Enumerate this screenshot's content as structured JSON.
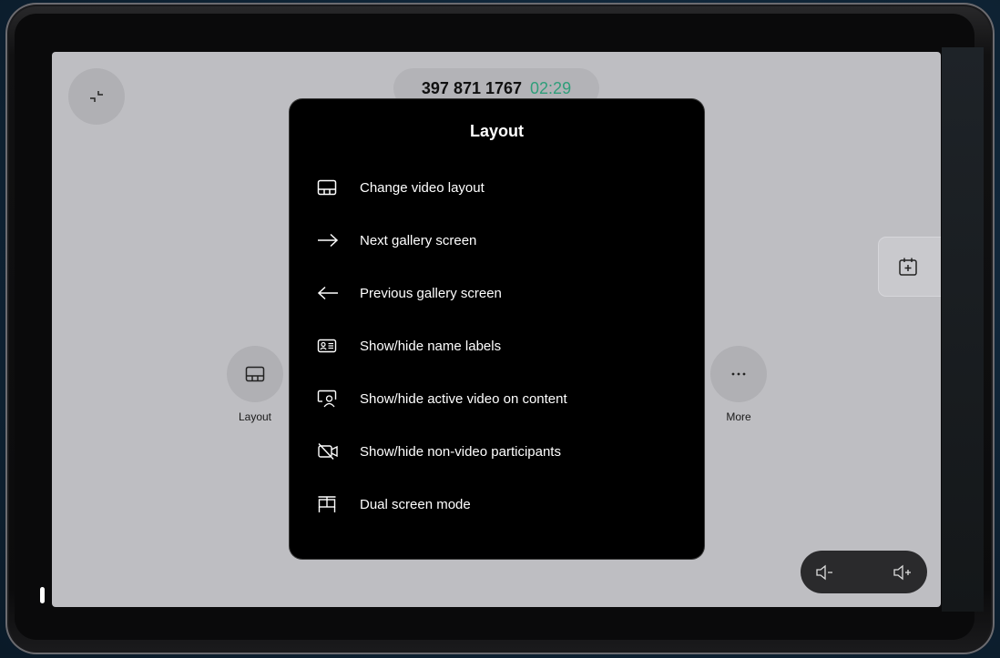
{
  "call": {
    "number": "397 871 1767",
    "duration": "02:29"
  },
  "dialog": {
    "title": "Layout",
    "items": [
      {
        "label": "Change video layout",
        "icon": "layout-icon"
      },
      {
        "label": "Next gallery screen",
        "icon": "arrow-right-icon"
      },
      {
        "label": "Previous gallery screen",
        "icon": "arrow-left-icon"
      },
      {
        "label": "Show/hide name labels",
        "icon": "name-label-icon"
      },
      {
        "label": "Show/hide active video on content",
        "icon": "active-video-icon"
      },
      {
        "label": "Show/hide non-video participants",
        "icon": "camera-off-icon"
      },
      {
        "label": "Dual screen mode",
        "icon": "dual-screen-icon"
      }
    ]
  },
  "controls": {
    "layout_label": "Layout",
    "more_label": "More"
  },
  "colors": {
    "accent_timer": "#2f9e7a",
    "dialog_bg": "#000000",
    "screen_bg": "#bebec2"
  }
}
